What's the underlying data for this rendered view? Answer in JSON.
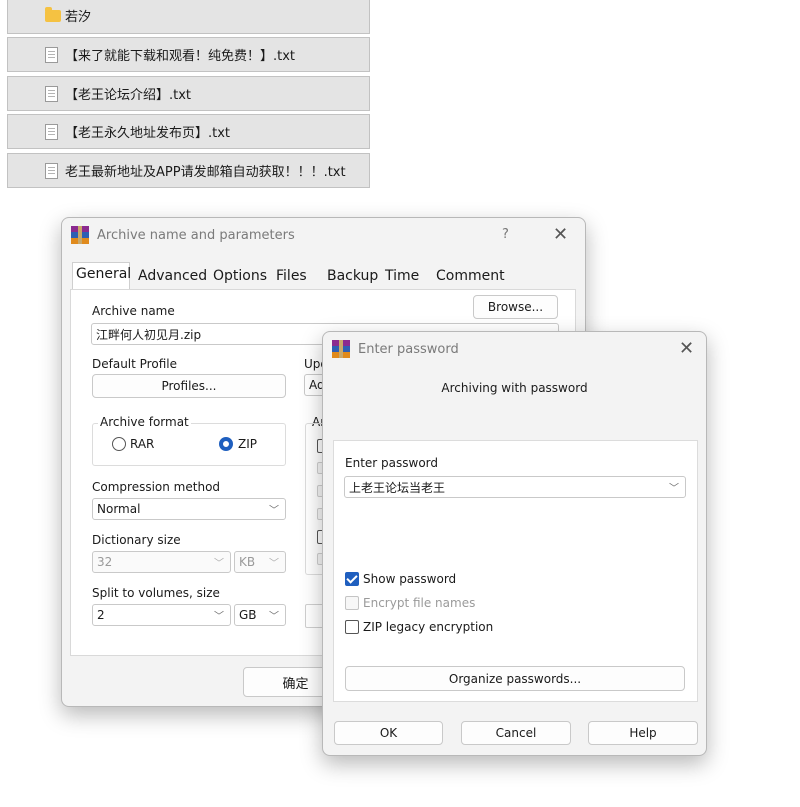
{
  "file_list": [
    {
      "name": "若汐",
      "icon": "folder-icon"
    },
    {
      "name": "【来了就能下载和观看！纯免费！】.txt",
      "icon": "text-file-icon"
    },
    {
      "name": "【老王论坛介绍】.txt",
      "icon": "text-file-icon"
    },
    {
      "name": "【老王永久地址发布页】.txt",
      "icon": "text-file-icon"
    },
    {
      "name": "老王最新地址及APP请发邮箱自动获取！！！.txt",
      "icon": "text-file-icon"
    }
  ],
  "archive_dialog": {
    "title": "Archive name and parameters",
    "help_glyph": "?",
    "tabs": [
      "General",
      "Advanced",
      "Options",
      "Files",
      "Backup",
      "Time",
      "Comment"
    ],
    "archive_name_label": "Archive name",
    "archive_name_value": "江畔何人初见月.zip",
    "browse_label": "Browse...",
    "default_profile_label": "Default Profile",
    "profiles_label": "Profiles...",
    "update_label_partial": "Upd",
    "update_value_partial": "Ad",
    "archiving_options_partial": "Ar",
    "archive_format_label": "Archive format",
    "format_rar": "RAR",
    "format_zip": "ZIP",
    "selected_format": "ZIP",
    "compression_method_label": "Compression method",
    "compression_method_value": "Normal",
    "dictionary_size_label": "Dictionary size",
    "dictionary_size_value": "32",
    "dictionary_unit": "KB",
    "split_label": "Split to volumes, size",
    "split_value": "2",
    "split_unit": "GB",
    "ok_label": "确定"
  },
  "password_dialog": {
    "title": "Enter password",
    "heading": "Archiving with password",
    "enter_password_label": "Enter password",
    "password_value": "上老王论坛当老王",
    "show_password_label": "Show password",
    "show_password_checked": true,
    "encrypt_names_label": "Encrypt file names",
    "encrypt_names_checked": false,
    "zip_legacy_label": "ZIP legacy encryption",
    "zip_legacy_checked": false,
    "organize_label": "Organize passwords...",
    "ok_label": "OK",
    "cancel_label": "Cancel",
    "help_label": "Help"
  },
  "colors": {
    "accent": "#1f5fbf",
    "file_row_bg": "#e4e4e4",
    "dialog_bg": "#f3f3f3"
  }
}
